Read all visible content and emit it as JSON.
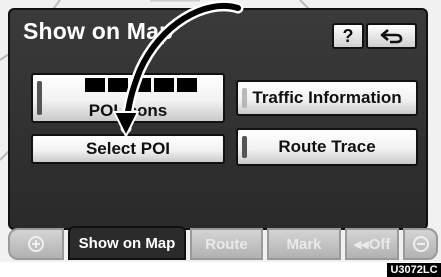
{
  "dialog": {
    "title": "Show on Map",
    "help_label": "?",
    "back_icon": "return-arrow-icon"
  },
  "buttons": {
    "poi_icons_label": "POI Icons",
    "traffic_info_label": "Traffic Information",
    "select_poi_label": "Select POI",
    "route_trace_label": "Route Trace"
  },
  "tabs": {
    "zoom_in_icon": "zoom-in-icon",
    "show_on_map": "Show on Map",
    "route": "Route",
    "mark": "Mark",
    "off": "◂◂Off",
    "zoom_out_icon": "zoom-out-icon"
  },
  "figure_code": "U3072LC"
}
